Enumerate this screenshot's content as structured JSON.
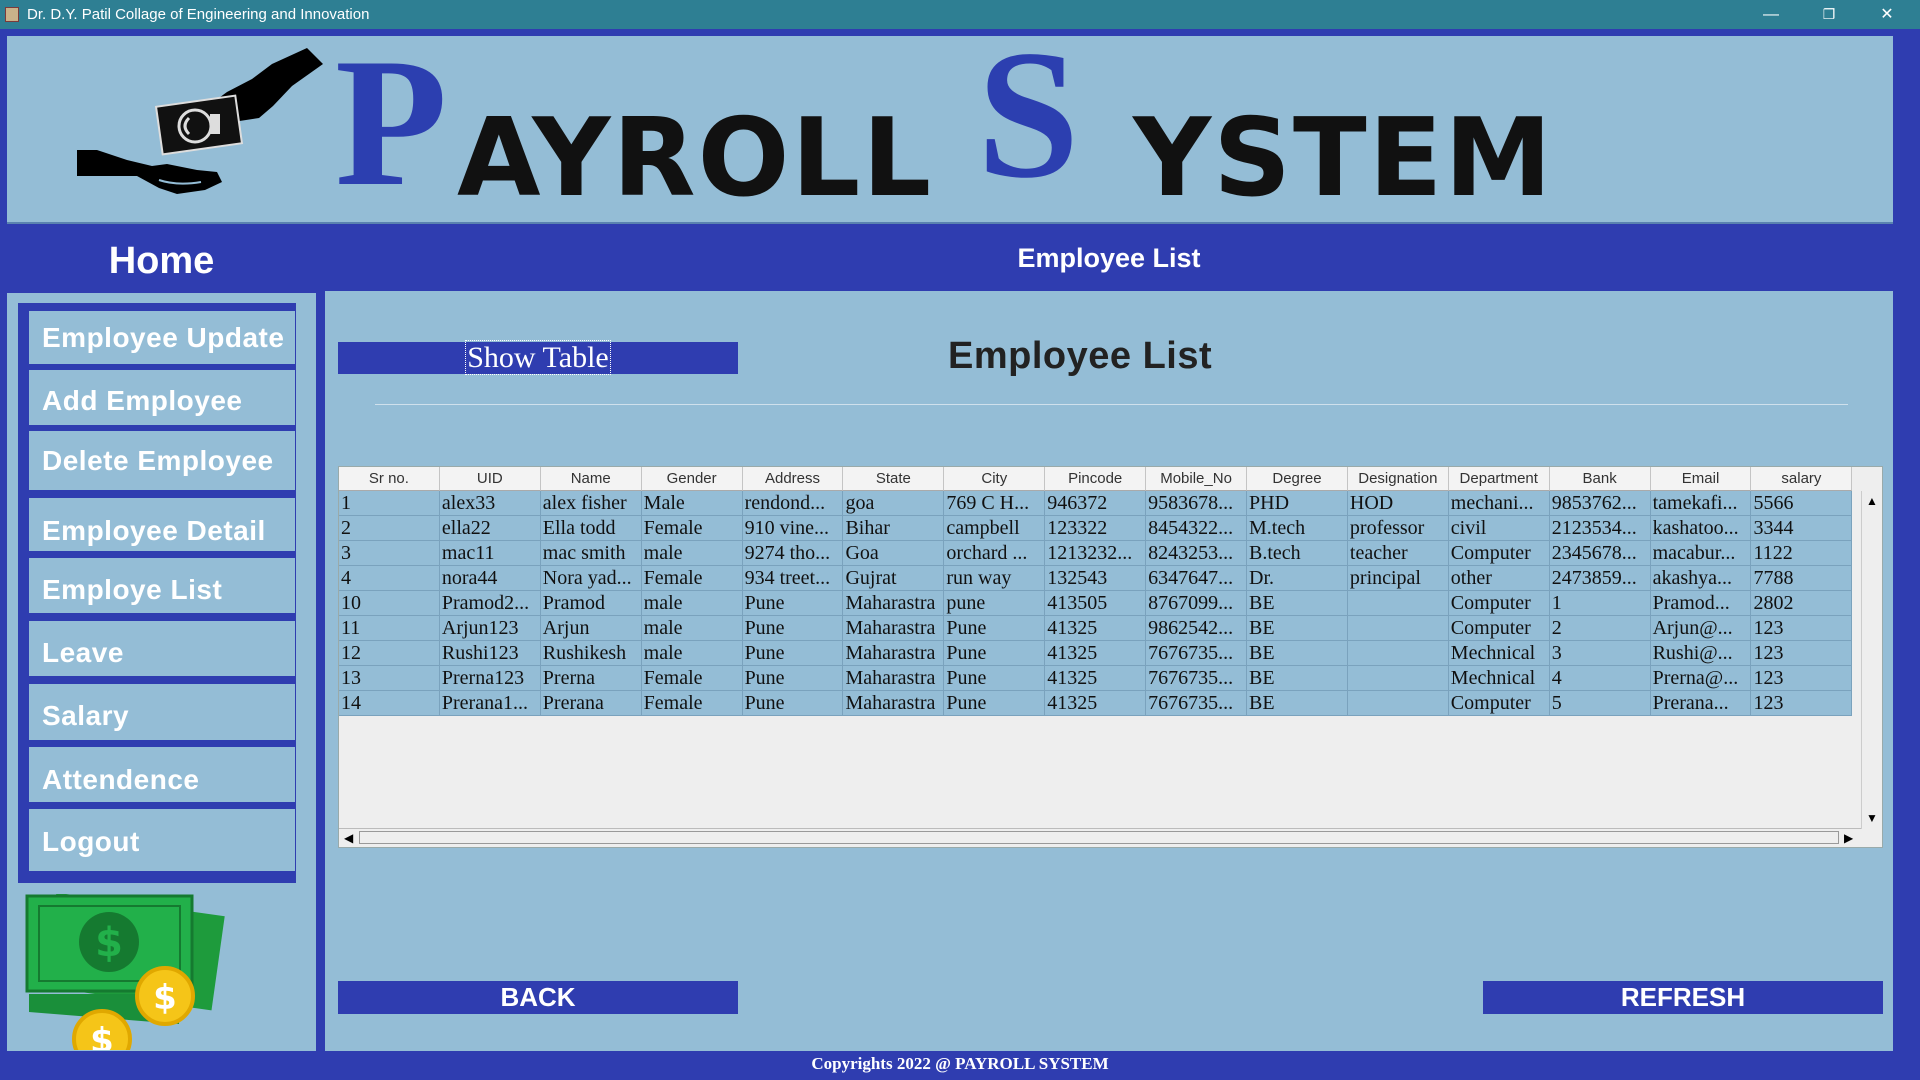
{
  "window": {
    "title": "Dr. D.Y. Patil Collage of Engineering and Innovation",
    "minimize_icon": "—",
    "restore_icon": "❐",
    "close_icon": "✕"
  },
  "header": {
    "title_p": "P",
    "title_p_rest": "AYROLL",
    "title_s": "S",
    "title_s_rest": "YSTEM"
  },
  "sidebar": {
    "home_label": "Home",
    "items": [
      {
        "label": "Employee Update"
      },
      {
        "label": "Add Employee"
      },
      {
        "label": "Delete Employee"
      },
      {
        "label": "Employee Detail"
      },
      {
        "label": "Employe List"
      },
      {
        "label": "Leave"
      },
      {
        "label": "Salary"
      },
      {
        "label": "Attendence"
      },
      {
        "label": "Logout"
      }
    ]
  },
  "main": {
    "header_title": "Employee List",
    "show_table_label": "Show Table",
    "list_title": "Employee List",
    "back_label": "BACK",
    "refresh_label": "REFRESH"
  },
  "table": {
    "columns": [
      "Sr no.",
      "UID",
      "Name",
      "Gender",
      "Address",
      "State",
      "City",
      "Pincode",
      "Mobile_No",
      "Degree",
      "Designation",
      "Department",
      "Bank",
      "Email",
      "salary"
    ],
    "rows": [
      [
        "1",
        "alex33",
        "alex fisher",
        "Male",
        "rendond...",
        "goa",
        "769 C H...",
        "946372",
        "9583678...",
        "PHD",
        "HOD",
        "mechani...",
        "9853762...",
        "tamekafi...",
        "5566"
      ],
      [
        "2",
        "ella22",
        "Ella todd",
        "Female",
        "910 vine...",
        "Bihar",
        "campbell",
        "123322",
        "8454322...",
        "M.tech",
        "professor",
        "civil",
        "2123534...",
        "kashatoo...",
        "3344"
      ],
      [
        "3",
        "mac11",
        "mac smith",
        "male",
        "9274 tho...",
        "Goa",
        "orchard ...",
        "1213232...",
        "8243253...",
        "B.tech",
        "teacher",
        "Computer",
        "2345678...",
        "macabur...",
        "1122"
      ],
      [
        "4",
        "nora44",
        "Nora yad...",
        "Female",
        "934 treet...",
        "Gujrat",
        "run way",
        "132543",
        "6347647...",
        "Dr.",
        "principal",
        "other",
        "2473859...",
        "akashya...",
        "7788"
      ],
      [
        "10",
        "Pramod2...",
        "Pramod",
        "male",
        "Pune",
        "Maharastra",
        "pune",
        "413505",
        "8767099...",
        "BE",
        "",
        "Computer",
        "1",
        "Pramod...",
        "2802"
      ],
      [
        "11",
        "Arjun123",
        "Arjun",
        "male",
        "Pune",
        "Maharastra",
        "Pune",
        "41325",
        "9862542...",
        "BE",
        "",
        "Computer",
        "2",
        "Arjun@...",
        "123"
      ],
      [
        "12",
        "Rushi123",
        "Rushikesh",
        "male",
        "Pune",
        "Maharastra",
        "Pune",
        "41325",
        "7676735...",
        "BE",
        "",
        "Mechnical",
        "3",
        "Rushi@...",
        "123"
      ],
      [
        "13",
        "Prerna123",
        "Prerna",
        "Female",
        "Pune",
        "Maharastra",
        "Pune",
        "41325",
        "7676735...",
        "BE",
        "",
        "Mechnical",
        "4",
        "Prerna@...",
        "123"
      ],
      [
        "14",
        "Prerana1...",
        "Prerana",
        "Female",
        "Pune",
        "Maharastra",
        "Pune",
        "41325",
        "7676735...",
        "BE",
        "",
        "Computer",
        "5",
        "Prerana...",
        "123"
      ]
    ]
  },
  "footer": {
    "copyright": "Copyrights 2022 @ PAYROLL SYSTEM"
  },
  "colors": {
    "primary_blue": "#2f3db0",
    "panel_light_blue": "#94bdd6",
    "titlebar_teal": "#2e7f93"
  },
  "icons": {
    "logo": "hand-money-icon",
    "money": "cash-coins-icon"
  }
}
